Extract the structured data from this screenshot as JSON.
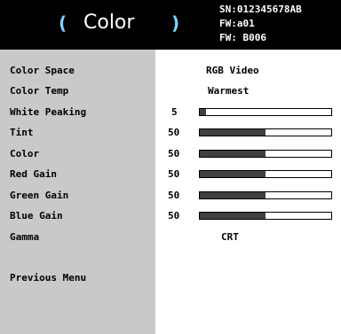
{
  "header": {
    "title": "Color",
    "paren_left": "(",
    "paren_right": ")",
    "sn": "SN:012345678AB",
    "fw1": "FW:a01",
    "fw2": "FW: B006"
  },
  "menu": {
    "rows": [
      {
        "label": "Color Space",
        "value": "RGB Video"
      },
      {
        "label": "Color Temp",
        "value": "Warmest"
      },
      {
        "label": "White Peaking",
        "number": "5",
        "level": 0.05
      },
      {
        "label": "Tint",
        "number": "50",
        "level": 0.5
      },
      {
        "label": "Color",
        "number": "50",
        "level": 0.5
      },
      {
        "label": "Red Gain",
        "number": "50",
        "level": 0.5
      },
      {
        "label": "Green Gain",
        "number": "50",
        "level": 0.5
      },
      {
        "label": "Blue Gain",
        "number": "50",
        "level": 0.5
      },
      {
        "label": "Gamma",
        "value": "CRT"
      }
    ],
    "previous": "Previous Menu"
  },
  "colors": {
    "header_bg": "#000000",
    "paren_color": "#7fd0ff",
    "left_panel": "#c9c9c9",
    "bar_fill": "#404040"
  }
}
